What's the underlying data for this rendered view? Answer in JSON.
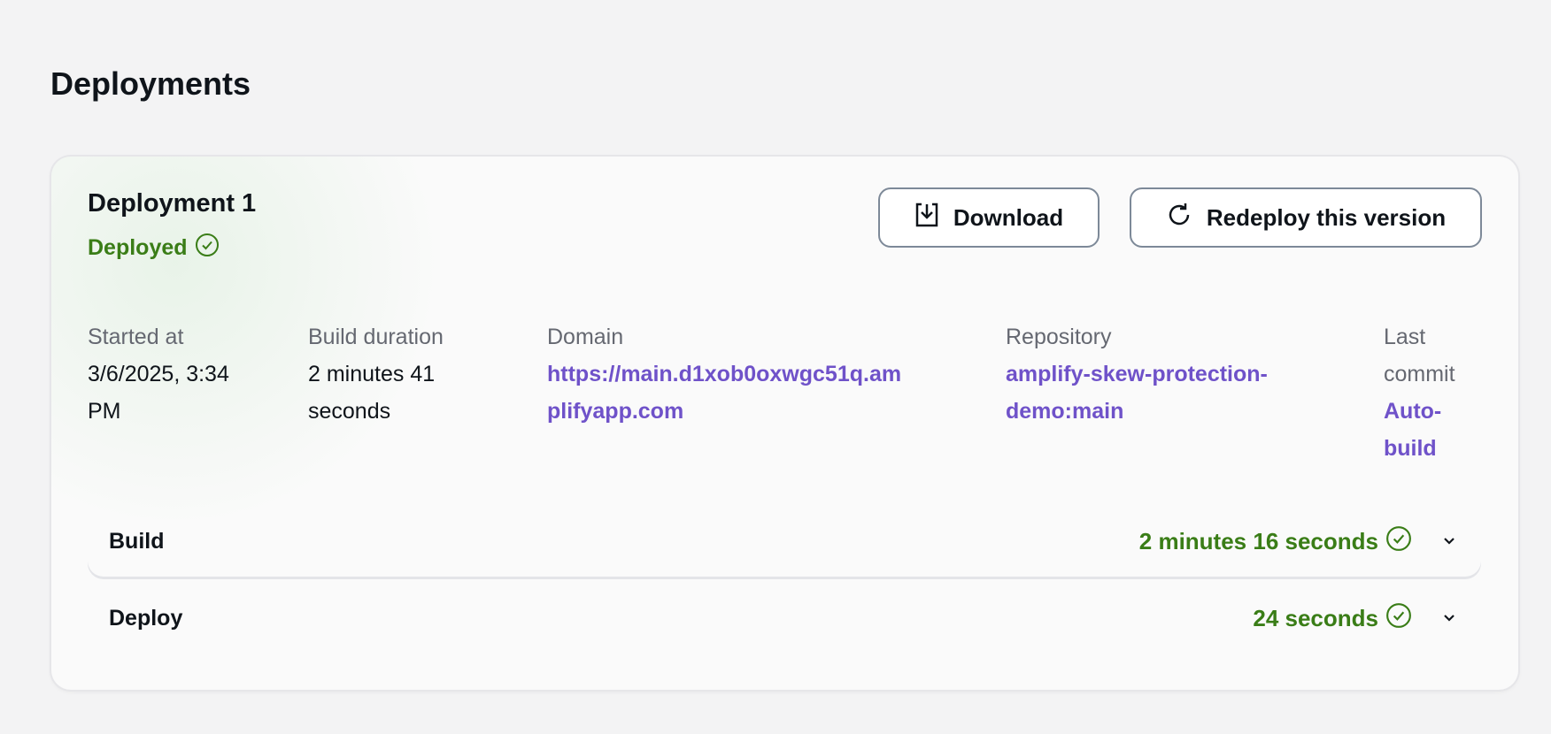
{
  "page": {
    "title": "Deployments"
  },
  "deployment": {
    "title": "Deployment 1",
    "status": "Deployed",
    "buttons": {
      "download": "Download",
      "redeploy": "Redeploy this version"
    },
    "details": [
      {
        "label": "Started at",
        "value": "3/6/2025, 3:34 PM"
      },
      {
        "label": "Build duration",
        "value": "2 minutes 41 seconds"
      },
      {
        "label": "Domain",
        "value": "https://main.d1xob0oxwgc51q.amplifyapp.com"
      },
      {
        "label": "Repository",
        "value": "amplify-skew-protection-demo:main"
      },
      {
        "label": "Last commit",
        "value": "Auto-build"
      }
    ],
    "steps": [
      {
        "name": "Build",
        "duration": "2 minutes 16 seconds"
      },
      {
        "name": "Deploy",
        "duration": "24 seconds"
      }
    ]
  },
  "colors": {
    "success": "#3a7d17",
    "link": "#6f52c9"
  }
}
